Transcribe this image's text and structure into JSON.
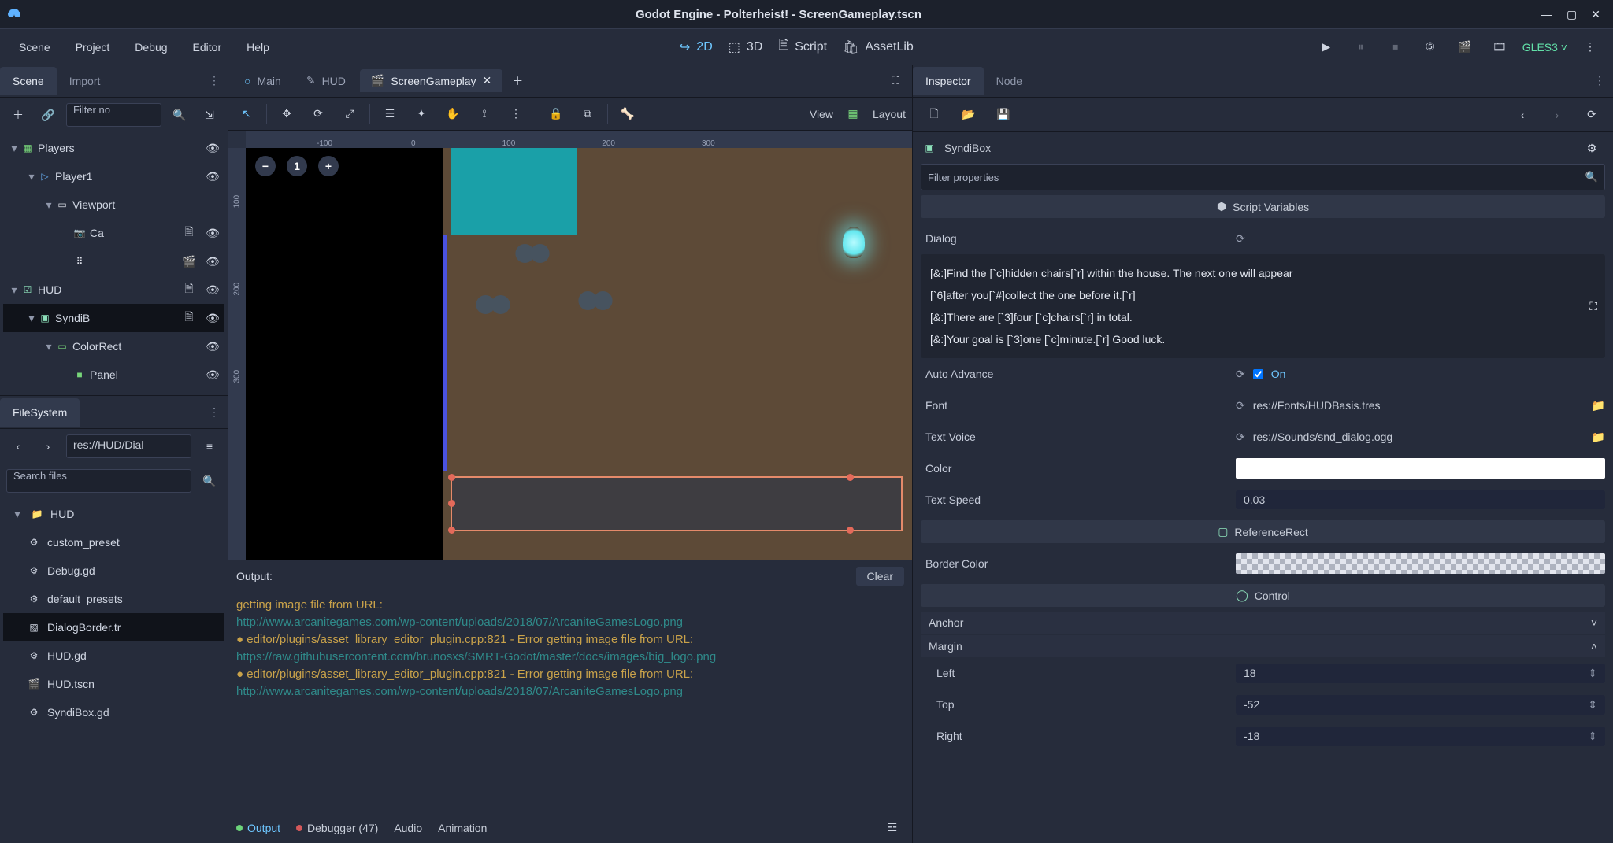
{
  "title": "Godot Engine - Polterheist! - ScreenGameplay.tscn",
  "menu": [
    "Scene",
    "Project",
    "Debug",
    "Editor",
    "Help"
  ],
  "workspace": {
    "items": [
      "2D",
      "3D",
      "Script",
      "AssetLib"
    ],
    "active": 0
  },
  "renderer": "GLES3",
  "left_docks": {
    "scene_tabs": [
      "Scene",
      "Import"
    ],
    "scene_tab_active": 0,
    "filter_placeholder": "Filter no",
    "tree": [
      {
        "depth": 0,
        "icon": "grid",
        "color": "col-green",
        "label": "Players",
        "toggle": "▾",
        "extra": "eye"
      },
      {
        "depth": 1,
        "icon": "play",
        "color": "col-blue",
        "label": "Player1",
        "toggle": "▾",
        "extra": "eye"
      },
      {
        "depth": 2,
        "icon": "rect",
        "color": "col-white",
        "label": "Viewport",
        "toggle": "▾"
      },
      {
        "depth": 3,
        "icon": "cam",
        "color": "col-viol",
        "label": "Ca",
        "extra": "script eye"
      },
      {
        "depth": 3,
        "icon": "dots",
        "color": "col-white",
        "label": "",
        "extra": "scene eye"
      },
      {
        "depth": 0,
        "icon": "check",
        "color": "col-cyan",
        "label": "HUD",
        "toggle": "▾",
        "extra": "script eye"
      },
      {
        "depth": 1,
        "icon": "box",
        "color": "col-cyan",
        "label": "SyndiB",
        "toggle": "▾",
        "extra": "script eye",
        "sel": true
      },
      {
        "depth": 2,
        "icon": "rect",
        "color": "col-green",
        "label": "ColorRect",
        "toggle": "▾",
        "extra": "eye"
      },
      {
        "depth": 3,
        "icon": "panel",
        "color": "col-green",
        "label": "Panel",
        "extra": "eye"
      }
    ],
    "fs_title": "FileSystem",
    "fs_path": "res://HUD/Dial",
    "fs_search": "Search files",
    "fs_tree": [
      {
        "icon": "folder",
        "label": "HUD",
        "folder": true
      },
      {
        "icon": "gear",
        "label": "custom_preset"
      },
      {
        "icon": "gear",
        "label": "Debug.gd"
      },
      {
        "icon": "gear",
        "label": "default_presets"
      },
      {
        "icon": "grad",
        "label": "DialogBorder.tr",
        "sel": true
      },
      {
        "icon": "gear",
        "label": "HUD.gd"
      },
      {
        "icon": "scene",
        "label": "HUD.tscn"
      },
      {
        "icon": "gear",
        "label": "SyndiBox.gd"
      }
    ]
  },
  "center": {
    "scene_tabs": [
      {
        "label": "Main",
        "dot": true
      },
      {
        "label": "HUD",
        "edit": true
      },
      {
        "label": "ScreenGameplay",
        "active": true,
        "close": true
      }
    ],
    "view_label": "View",
    "layout_label": "Layout",
    "output": {
      "title": "Output:",
      "clear": "Clear",
      "lines": [
        {
          "t": "getting image file from URL:"
        },
        {
          "t": "http://www.arcanitegames.com/wp-content/uploads/2018/07/ArcaniteGamesLogo.png",
          "link": true
        },
        {
          "t": "● editor/plugins/asset_library_editor_plugin.cpp:821 - Error getting image file from URL:"
        },
        {
          "t": "https://raw.githubusercontent.com/brunosxs/SMRT-Godot/master/docs/images/big_logo.png",
          "link": true
        },
        {
          "t": "● editor/plugins/asset_library_editor_plugin.cpp:821 - Error getting image file from URL:"
        },
        {
          "t": "http://www.arcanitegames.com/wp-content/uploads/2018/07/ArcaniteGamesLogo.png",
          "link": true
        }
      ],
      "footer": [
        {
          "dot": "g",
          "label": "Output",
          "hl": true
        },
        {
          "dot": "r",
          "label": "Debugger (47)"
        },
        {
          "label": "Audio"
        },
        {
          "label": "Animation"
        }
      ]
    }
  },
  "inspector": {
    "tabs": [
      "Inspector",
      "Node"
    ],
    "tab_active": 0,
    "node_name": "SyndiBox",
    "filter": "Filter properties",
    "script_section": "Script Variables",
    "dialog_label": "Dialog",
    "dialog_lines": [
      "[&:]Find the [`c]hidden chairs[`r] within the house. The next one will appear",
      "[`6]after you[`#]collect the one before it.[`r]",
      "[&:]There are [`3]four [`c]chairs[`r] in total.",
      "[&:]Your goal is [`3]one [`c]minute.[`r] Good luck."
    ],
    "auto_advance": {
      "label": "Auto Advance",
      "value": "On"
    },
    "font": {
      "label": "Font",
      "value": "res://Fonts/HUDBasis.tres"
    },
    "text_voice": {
      "label": "Text Voice",
      "value": "res://Sounds/snd_dialog.ogg"
    },
    "color": {
      "label": "Color"
    },
    "text_speed": {
      "label": "Text Speed",
      "value": "0.03"
    },
    "ref_rect": "ReferenceRect",
    "border_color": {
      "label": "Border Color"
    },
    "control": "Control",
    "anchor": "Anchor",
    "margin": "Margin",
    "margin_left": {
      "label": "Left",
      "value": "18"
    },
    "margin_top": {
      "label": "Top",
      "value": "-52"
    },
    "margin_right": {
      "label": "Right",
      "value": "-18"
    }
  }
}
